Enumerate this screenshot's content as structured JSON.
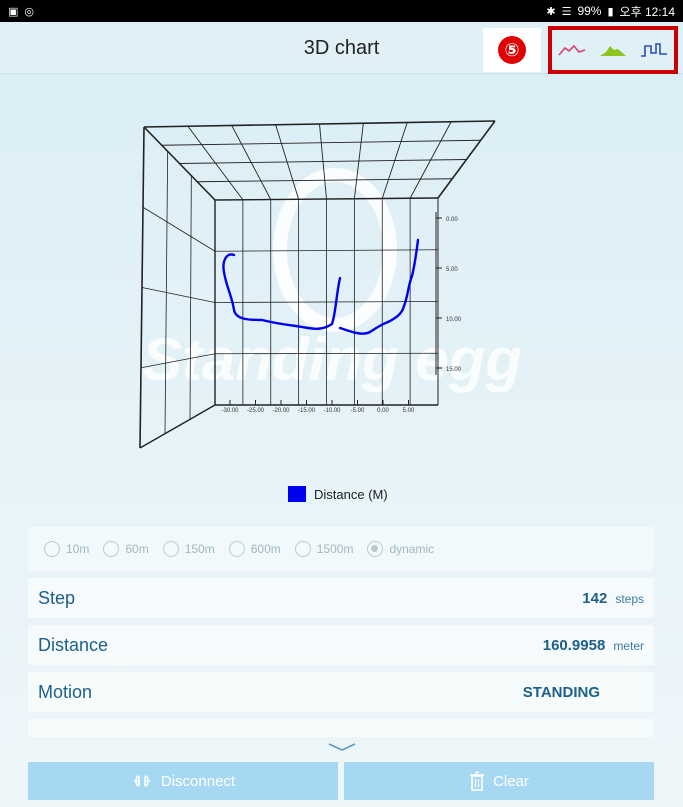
{
  "status_bar": {
    "battery": "99%",
    "time": "오후 12:14"
  },
  "header": {
    "title": "3D chart",
    "annotation_number": "⑤",
    "chart_switch": [
      "line-chart-icon",
      "area-chart-icon",
      "step-chart-icon"
    ]
  },
  "chart_data": {
    "type": "line",
    "y_ticks": [
      "0.00",
      "5.00",
      "10.00",
      "15.00"
    ],
    "x_ticks": [
      "-30.00",
      "-25.00",
      "-20.00",
      "-15.00",
      "-10.00",
      "-5.00",
      "0.00",
      "5.00"
    ],
    "legend": "Distance (M)",
    "series_color": "#0000ee"
  },
  "watermark": "Standing egg",
  "range_options": {
    "items": [
      "10m",
      "60m",
      "150m",
      "600m",
      "1500m",
      "dynamic"
    ],
    "selected": "dynamic"
  },
  "info": {
    "step": {
      "label": "Step",
      "value": "142",
      "unit": "steps"
    },
    "distance": {
      "label": "Distance",
      "value": "160.9958",
      "unit": "meter"
    },
    "motion": {
      "label": "Motion",
      "value": "STANDING"
    }
  },
  "buttons": {
    "disconnect": "Disconnect",
    "clear": "Clear"
  },
  "colors": {
    "accent": "#1d5f8a",
    "button": "#a7d8f2",
    "highlight": "#cc0000"
  }
}
